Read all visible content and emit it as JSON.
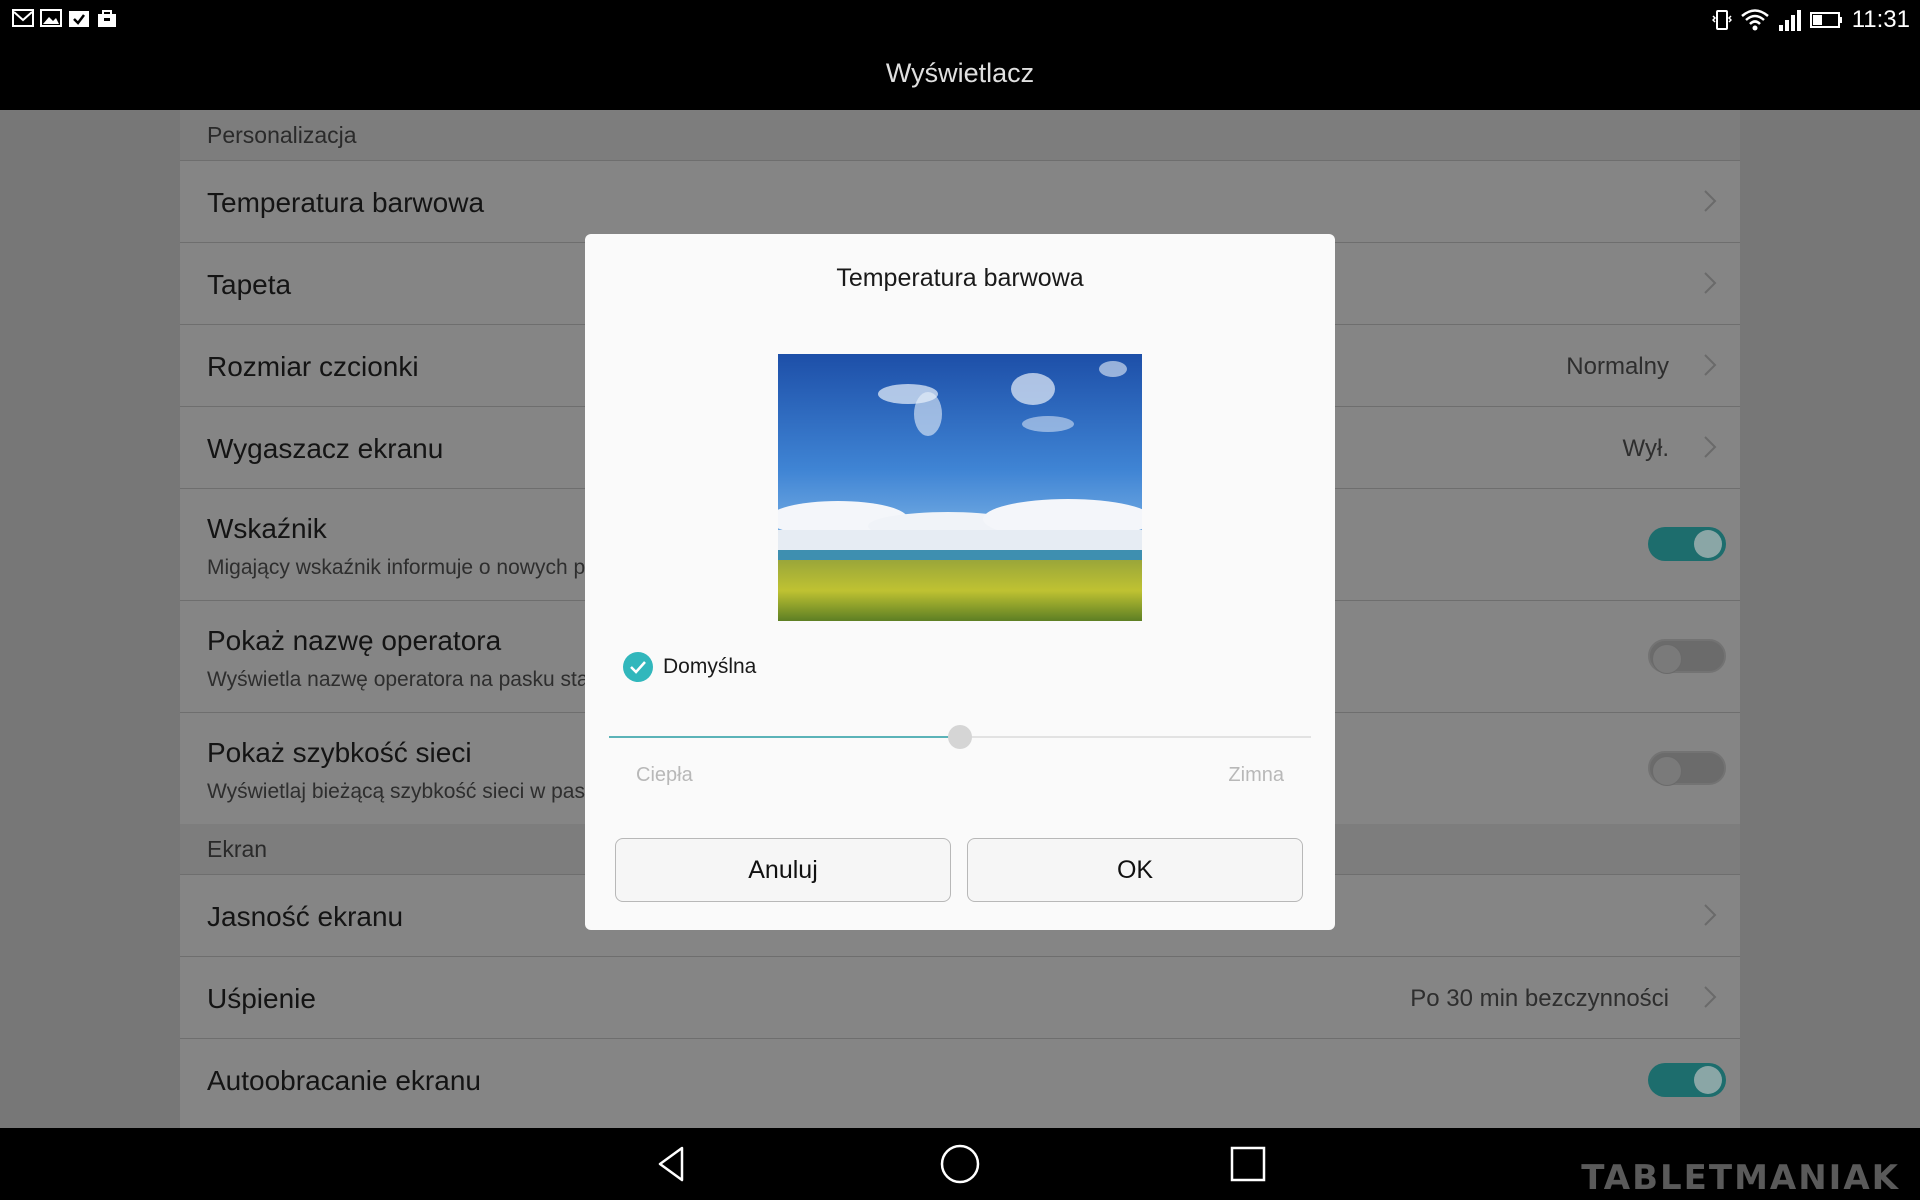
{
  "status_bar": {
    "time": "11:31",
    "left_icons": [
      "gmail-icon",
      "gallery-icon",
      "calendar-check-icon",
      "bag-icon"
    ],
    "right_icons": [
      "vibrate-icon",
      "wifi-icon",
      "signal-icon",
      "battery-icon"
    ]
  },
  "title_bar": {
    "title": "Wyświetlacz"
  },
  "settings": {
    "section_personalization": "Personalizacja",
    "rows": [
      {
        "title": "Temperatura barwowa"
      },
      {
        "title": "Tapeta"
      },
      {
        "title": "Rozmiar czcionki",
        "value": "Normalny"
      },
      {
        "title": "Wygaszacz ekranu",
        "value": "Wył."
      },
      {
        "title": "Wskaźnik",
        "subtitle": "Migający wskaźnik informuje o nowych p",
        "toggle": "on"
      },
      {
        "title": "Pokaż nazwę operatora",
        "subtitle": "Wyświetla nazwę operatora na pasku sta",
        "toggle": "off"
      },
      {
        "title": "Pokaż szybkość sieci",
        "subtitle": "Wyświetlaj bieżącą szybkość sieci w pas",
        "toggle": "off"
      }
    ],
    "section_screen": "Ekran",
    "rows2": [
      {
        "title": "Jasność ekranu"
      },
      {
        "title": "Uśpienie",
        "value": "Po 30 min bezczynności"
      },
      {
        "title": "Autoobracanie ekranu",
        "toggle": "on"
      }
    ]
  },
  "dialog": {
    "title": "Temperatura barwowa",
    "checkbox_label": "Domyślna",
    "checkbox_checked": true,
    "slider_value": 0.5,
    "label_warm": "Ciepła",
    "label_cold": "Zimna",
    "cancel_label": "Anuluj",
    "ok_label": "OK"
  },
  "nav_bar": {
    "icons": [
      "back-icon",
      "home-icon",
      "recents-icon"
    ],
    "watermark": "TABLETMANIAK"
  },
  "colors": {
    "accent": "#31b7bc",
    "toggle_on": "#1d6d6d"
  }
}
